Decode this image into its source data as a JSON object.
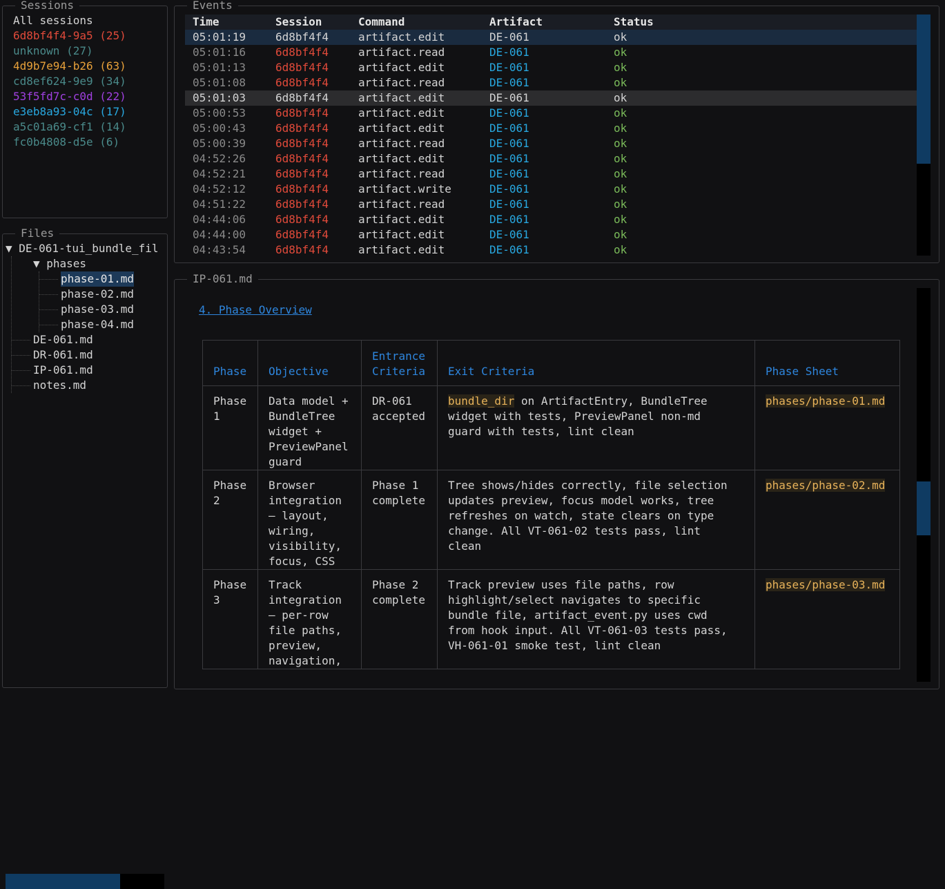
{
  "sessions": {
    "title": "Sessions",
    "items": [
      {
        "label": "All sessions",
        "color": "#d4d4d4"
      },
      {
        "label": "6d8bf4f4-9a5 (25)",
        "color": "#e04a3a"
      },
      {
        "label": "unknown (27)",
        "color": "#4a8a8a"
      },
      {
        "label": "4d9b7e94-b26 (63)",
        "color": "#e8a13a"
      },
      {
        "label": "cd8ef624-9e9 (34)",
        "color": "#4a8a8a"
      },
      {
        "label": "53f5fd7c-c0d (22)",
        "color": "#a040e0"
      },
      {
        "label": "e3eb8a93-04c (17)",
        "color": "#28a8e0"
      },
      {
        "label": "a5c01a69-cf1 (14)",
        "color": "#4a8a8a"
      },
      {
        "label": "fc0b4808-d5e (6)",
        "color": "#4a8a8a"
      }
    ]
  },
  "files": {
    "title": "Files",
    "root": "▼ DE-061-tui_bundle_fil",
    "phases_folder": "▼ phases",
    "phase_files": [
      "phase-01.md",
      "phase-02.md",
      "phase-03.md",
      "phase-04.md"
    ],
    "root_files": [
      "DE-061.md",
      "DR-061.md",
      "IP-061.md",
      "notes.md"
    ],
    "scroll_fraction": 0.72
  },
  "events": {
    "title": "Events",
    "columns": [
      "Time",
      "Session",
      "Command",
      "Artifact",
      "Status"
    ],
    "rows": [
      {
        "time": "05:01:19",
        "session": "6d8bf4f4",
        "command": "artifact.edit",
        "artifact": "DE-061",
        "status": "ok"
      },
      {
        "time": "05:01:16",
        "session": "6d8bf4f4",
        "command": "artifact.read",
        "artifact": "DE-061",
        "status": "ok"
      },
      {
        "time": "05:01:13",
        "session": "6d8bf4f4",
        "command": "artifact.edit",
        "artifact": "DE-061",
        "status": "ok"
      },
      {
        "time": "05:01:08",
        "session": "6d8bf4f4",
        "command": "artifact.read",
        "artifact": "DE-061",
        "status": "ok"
      },
      {
        "time": "05:01:03",
        "session": "6d8bf4f4",
        "command": "artifact.edit",
        "artifact": "DE-061",
        "status": "ok"
      },
      {
        "time": "05:00:53",
        "session": "6d8bf4f4",
        "command": "artifact.edit",
        "artifact": "DE-061",
        "status": "ok"
      },
      {
        "time": "05:00:43",
        "session": "6d8bf4f4",
        "command": "artifact.edit",
        "artifact": "DE-061",
        "status": "ok"
      },
      {
        "time": "05:00:39",
        "session": "6d8bf4f4",
        "command": "artifact.read",
        "artifact": "DE-061",
        "status": "ok"
      },
      {
        "time": "04:52:26",
        "session": "6d8bf4f4",
        "command": "artifact.edit",
        "artifact": "DE-061",
        "status": "ok"
      },
      {
        "time": "04:52:21",
        "session": "6d8bf4f4",
        "command": "artifact.read",
        "artifact": "DE-061",
        "status": "ok"
      },
      {
        "time": "04:52:12",
        "session": "6d8bf4f4",
        "command": "artifact.write",
        "artifact": "DE-061",
        "status": "ok"
      },
      {
        "time": "04:51:22",
        "session": "6d8bf4f4",
        "command": "artifact.read",
        "artifact": "DE-061",
        "status": "ok"
      },
      {
        "time": "04:44:06",
        "session": "6d8bf4f4",
        "command": "artifact.edit",
        "artifact": "DE-061",
        "status": "ok"
      },
      {
        "time": "04:44:00",
        "session": "6d8bf4f4",
        "command": "artifact.edit",
        "artifact": "DE-061",
        "status": "ok"
      },
      {
        "time": "04:43:54",
        "session": "6d8bf4f4",
        "command": "artifact.edit",
        "artifact": "DE-061",
        "status": "ok"
      }
    ]
  },
  "preview": {
    "title": "IP-061.md",
    "heading": "4. Phase Overview",
    "table": {
      "headers": [
        "Phase",
        "Objective",
        "Entrance\nCriteria",
        "Exit Criteria",
        "Phase Sheet"
      ],
      "rows": [
        {
          "phase": "Phase\n1",
          "objective": "Data model +\nBundleTree\nwidget +\nPreviewPanel\nguard",
          "entrance": "DR-061\naccepted",
          "exit_code": "bundle_dir",
          "exit_rest": " on ArtifactEntry, BundleTree\nwidget with tests, PreviewPanel non-md\nguard with tests, lint clean",
          "sheet": "phases/phase-01.md"
        },
        {
          "phase": "Phase\n2",
          "objective": "Browser\nintegration\n— layout,\nwiring,\nvisibility,\nfocus, CSS",
          "entrance": "Phase 1\ncomplete",
          "exit_code": "",
          "exit_rest": "Tree shows/hides correctly, file selection\nupdates preview, focus model works, tree\nrefreshes on watch, state clears on type\nchange. All VT-061-02 tests pass, lint\nclean",
          "sheet": "phases/phase-02.md"
        },
        {
          "phase": "Phase\n3",
          "objective": "Track\nintegration\n— per-row\nfile paths,\npreview,\nnavigation,",
          "entrance": "Phase 2\ncomplete",
          "exit_code": "",
          "exit_rest": "Track preview uses file paths, row\nhighlight/select navigates to specific\nbundle file, artifact_event.py uses cwd\nfrom hook input. All VT-061-03 tests pass,\nVH-061-01 smoke test, lint clean",
          "sheet": "phases/phase-03.md"
        }
      ]
    }
  }
}
